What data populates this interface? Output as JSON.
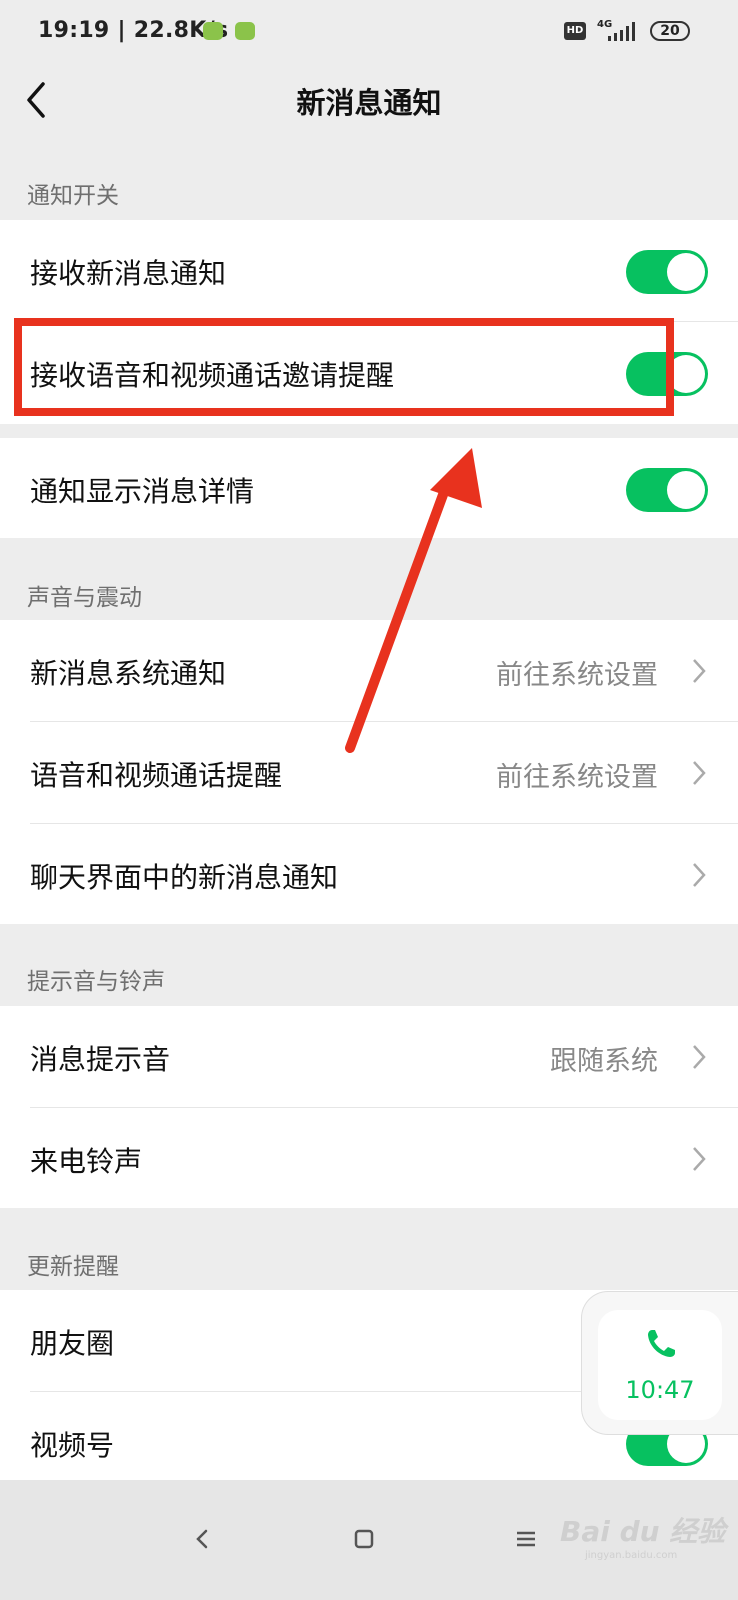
{
  "status_bar": {
    "time": "19:19",
    "speed": "22.8K/s",
    "hd": "HD",
    "network": "4G",
    "battery": "20"
  },
  "nav": {
    "title": "新消息通知"
  },
  "sections": {
    "notify": {
      "label": "通知开关",
      "rows": [
        {
          "label": "接收新消息通知",
          "toggle": true
        },
        {
          "label": "接收语音和视频通话邀请提醒",
          "toggle": true
        },
        {
          "label": "通知显示消息详情",
          "toggle": true
        }
      ]
    },
    "sound": {
      "label": "声音与震动",
      "rows": [
        {
          "label": "新消息系统通知",
          "value": "前往系统设置"
        },
        {
          "label": "语音和视频通话提醒",
          "value": "前往系统设置"
        },
        {
          "label": "聊天界面中的新消息通知",
          "value": ""
        }
      ]
    },
    "ringtone": {
      "label": "提示音与铃声",
      "rows": [
        {
          "label": "消息提示音",
          "value": "跟随系统"
        },
        {
          "label": "来电铃声",
          "value": ""
        }
      ]
    },
    "updates": {
      "label": "更新提醒",
      "rows": [
        {
          "label": "朋友圈",
          "toggle": true
        },
        {
          "label": "视频号",
          "toggle": true
        }
      ]
    }
  },
  "float_call": {
    "time": "10:47"
  },
  "watermark": {
    "main": "Bai du 经验",
    "sub": "jingyan.baidu.com"
  },
  "colors": {
    "accent": "#07c160",
    "highlight": "#e8321e"
  }
}
